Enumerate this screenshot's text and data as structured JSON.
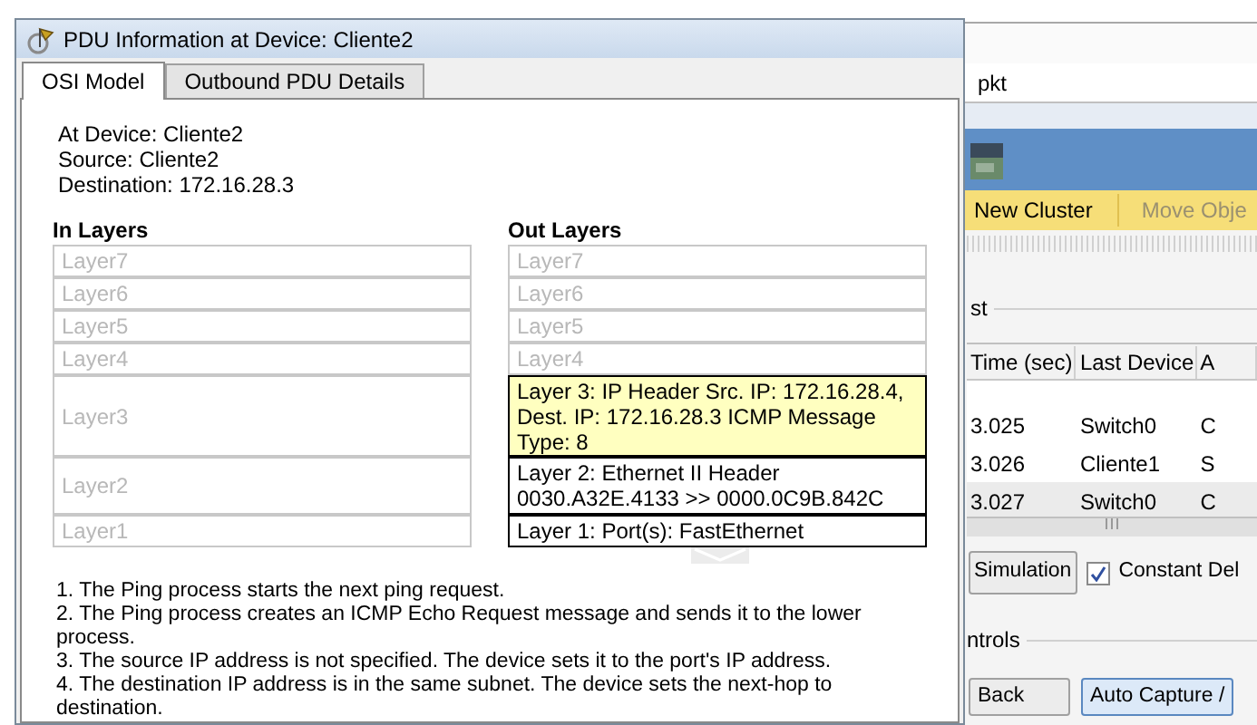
{
  "dialog": {
    "title": "PDU Information at Device: Cliente2",
    "tabs": [
      {
        "label": "OSI Model",
        "selected": true
      },
      {
        "label": "Outbound PDU Details",
        "selected": false
      }
    ],
    "info": [
      "At Device: Cliente2",
      "Source: Cliente2",
      "Destination: 172.16.28.3"
    ],
    "in_layers": {
      "heading": "In Layers",
      "layers": [
        {
          "text": "Layer7",
          "active": false,
          "selected": false
        },
        {
          "text": "Layer6",
          "active": false,
          "selected": false
        },
        {
          "text": "Layer5",
          "active": false,
          "selected": false
        },
        {
          "text": "Layer4",
          "active": false,
          "selected": false
        },
        {
          "text": "Layer3",
          "active": false,
          "selected": false
        },
        {
          "text": "Layer2",
          "active": false,
          "selected": false
        },
        {
          "text": "Layer1",
          "active": false,
          "selected": false
        }
      ]
    },
    "out_layers": {
      "heading": "Out Layers",
      "layers": [
        {
          "text": "Layer7",
          "active": false,
          "selected": false
        },
        {
          "text": "Layer6",
          "active": false,
          "selected": false
        },
        {
          "text": "Layer5",
          "active": false,
          "selected": false
        },
        {
          "text": "Layer4",
          "active": false,
          "selected": false
        },
        {
          "text": "Layer 3: IP Header Src. IP: 172.16.28.4, Dest. IP: 172.16.28.3 ICMP Message Type: 8",
          "active": true,
          "selected": true
        },
        {
          "text": "Layer 2: Ethernet II Header 0030.A32E.4133 >> 0000.0C9B.842C",
          "active": true,
          "selected": false
        },
        {
          "text": "Layer 1: Port(s): FastEthernet",
          "active": true,
          "selected": false
        }
      ]
    },
    "steps": [
      "1. The Ping process starts the next ping request.",
      "2. The Ping process creates an ICMP Echo Request message and sends it to the lower process.",
      "3. The source IP address is not specified. The device sets it to the port's IP address.",
      "4. The destination IP address is in the same subnet. The device sets the next-hop to destination."
    ]
  },
  "background_window": {
    "title": "pkt",
    "toolbar": [
      "New Cluster",
      "Move Obje"
    ],
    "event_list": {
      "label": "st",
      "columns": [
        "Time (sec)",
        "Last Device",
        "A"
      ],
      "rows": [
        {
          "cells": [
            "3.025",
            "Switch0",
            "C"
          ],
          "selected": false
        },
        {
          "cells": [
            "3.026",
            "Cliente1",
            "S"
          ],
          "selected": false
        },
        {
          "cells": [
            "3.027",
            "Switch0",
            "C"
          ],
          "selected": true
        }
      ]
    },
    "simulation_button": "Simulation",
    "constant_delay": {
      "label": "Constant Del",
      "checked": true
    },
    "controls_label": "ntrols",
    "buttons": [
      {
        "label": "Back",
        "kind": "plain"
      },
      {
        "label": "Auto Capture /",
        "kind": "primary"
      }
    ]
  }
}
